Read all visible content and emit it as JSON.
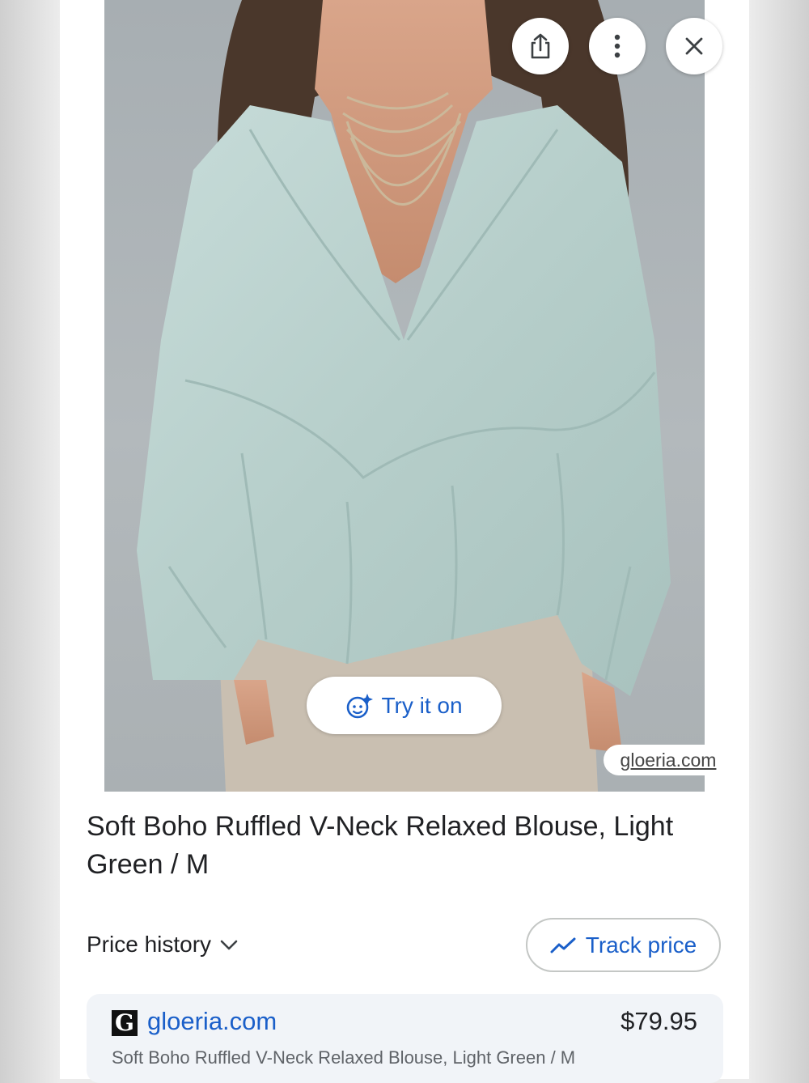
{
  "image": {
    "source_label": "gloeria.com"
  },
  "overlay_buttons": {
    "share_icon": "share-icon",
    "more_icon": "more-vert-icon",
    "close_icon": "close-icon"
  },
  "try_on": {
    "label": "Try it on"
  },
  "product": {
    "title": "Soft Boho Ruffled V-Neck Relaxed Blouse, Light Green / M"
  },
  "price_history": {
    "label": "Price history"
  },
  "track_price": {
    "label": "Track price"
  },
  "offer": {
    "logo_letter": "G",
    "site": "gloeria.com",
    "price": "$79.95",
    "description": "Soft Boho Ruffled V-Neck Relaxed Blouse, Light Green / M"
  },
  "colors": {
    "accent_blue": "#1a5fc9",
    "text_primary": "#202124",
    "offer_bg": "#f1f4f8"
  }
}
